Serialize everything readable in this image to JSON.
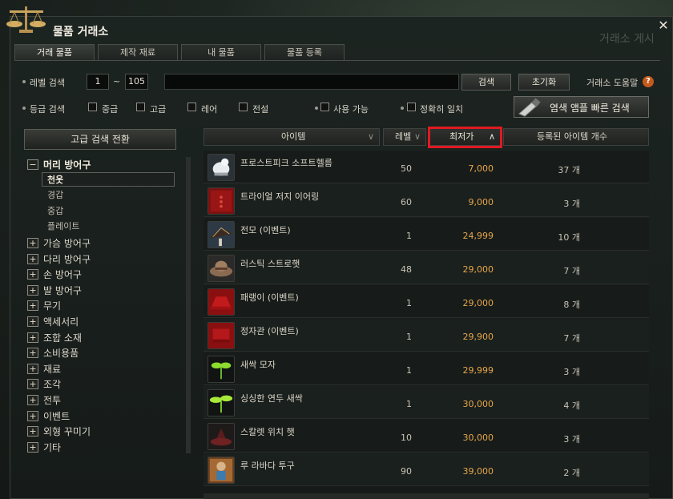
{
  "window": {
    "title": "물품 거래소",
    "close": "✕",
    "watermark": "거래소 게시"
  },
  "tabs": [
    {
      "label": "거래 물품",
      "active": true
    },
    {
      "label": "제작 재료",
      "active": false
    },
    {
      "label": "내 물품",
      "active": false
    },
    {
      "label": "물품 등록",
      "active": false
    }
  ],
  "search": {
    "level_label": "레벨 검색",
    "level_min": "1",
    "level_sep": "~",
    "level_max": "105",
    "query_value": "",
    "search_button": "검색",
    "reset_button": "초기화",
    "help_label": "거래소 도움말",
    "help_icon": "?",
    "grade_label": "등급 검색",
    "grades": [
      "중급",
      "고급",
      "레어",
      "전설"
    ],
    "usable_label": "사용 가능",
    "exact_label": "정확히 일치",
    "lamp_button": "염색 앰플 빠른 검색"
  },
  "sidebar": {
    "advanced_button": "고급 검색 전환",
    "expanded": {
      "label": "머리 방어구",
      "toggle": "−",
      "children": [
        "천옷",
        "경갑",
        "중갑",
        "플레이트"
      ],
      "selected_index": 0
    },
    "categories": [
      {
        "label": "가슴 방어구",
        "toggle": "+"
      },
      {
        "label": "다리 방어구",
        "toggle": "+"
      },
      {
        "label": "손 방어구",
        "toggle": "+"
      },
      {
        "label": "발 방어구",
        "toggle": "+"
      },
      {
        "label": "무기",
        "toggle": "+"
      },
      {
        "label": "액세서리",
        "toggle": "+"
      },
      {
        "label": "조합 소재",
        "toggle": "+"
      },
      {
        "label": "소비용품",
        "toggle": "+"
      },
      {
        "label": "재료",
        "toggle": "+"
      },
      {
        "label": "조각",
        "toggle": "+"
      },
      {
        "label": "전투",
        "toggle": "+"
      },
      {
        "label": "이벤트",
        "toggle": "+"
      },
      {
        "label": "외형 꾸미기",
        "toggle": "+"
      },
      {
        "label": "기타",
        "toggle": "+"
      }
    ]
  },
  "table": {
    "headers": {
      "item": "아이템",
      "level": "레벨",
      "min_price": "최저가",
      "registered": "등록된 아이템 개수",
      "item_caret": "∨",
      "level_caret": "∨",
      "price_caret": "∧"
    },
    "colors": {
      "price": "#e6a54b",
      "highlight": "#e01a22"
    },
    "rows": [
      {
        "name": "프로스트피크 소프트헬름",
        "level": "50",
        "price": "7,000",
        "count": "37 개",
        "icon": "frost-helm-icon"
      },
      {
        "name": "트라이얼 저지 이어링",
        "level": "60",
        "price": "9,000",
        "count": "3 개",
        "icon": "earring-icon"
      },
      {
        "name": "전모 (이벤트)",
        "level": "1",
        "price": "24,999",
        "count": "10 개",
        "icon": "umbrella-hat-icon"
      },
      {
        "name": "러스틱 스트로햇",
        "level": "48",
        "price": "29,000",
        "count": "7 개",
        "icon": "straw-hat-icon"
      },
      {
        "name": "패랭이 (이벤트)",
        "level": "1",
        "price": "29,000",
        "count": "8 개",
        "icon": "red-hat-icon"
      },
      {
        "name": "정자관 (이벤트)",
        "level": "1",
        "price": "29,900",
        "count": "7 개",
        "icon": "red-cap-icon"
      },
      {
        "name": "새싹 모자",
        "level": "1",
        "price": "29,999",
        "count": "3 개",
        "icon": "sprout-icon"
      },
      {
        "name": "싱싱한 연두 새싹",
        "level": "1",
        "price": "30,000",
        "count": "4 개",
        "icon": "green-sprout-icon"
      },
      {
        "name": "스칼렛 위치 햇",
        "level": "10",
        "price": "30,000",
        "count": "3 개",
        "icon": "witch-hat-icon"
      },
      {
        "name": "루 라바다 투구",
        "level": "90",
        "price": "39,000",
        "count": "2 개",
        "icon": "helmet-icon"
      }
    ]
  }
}
